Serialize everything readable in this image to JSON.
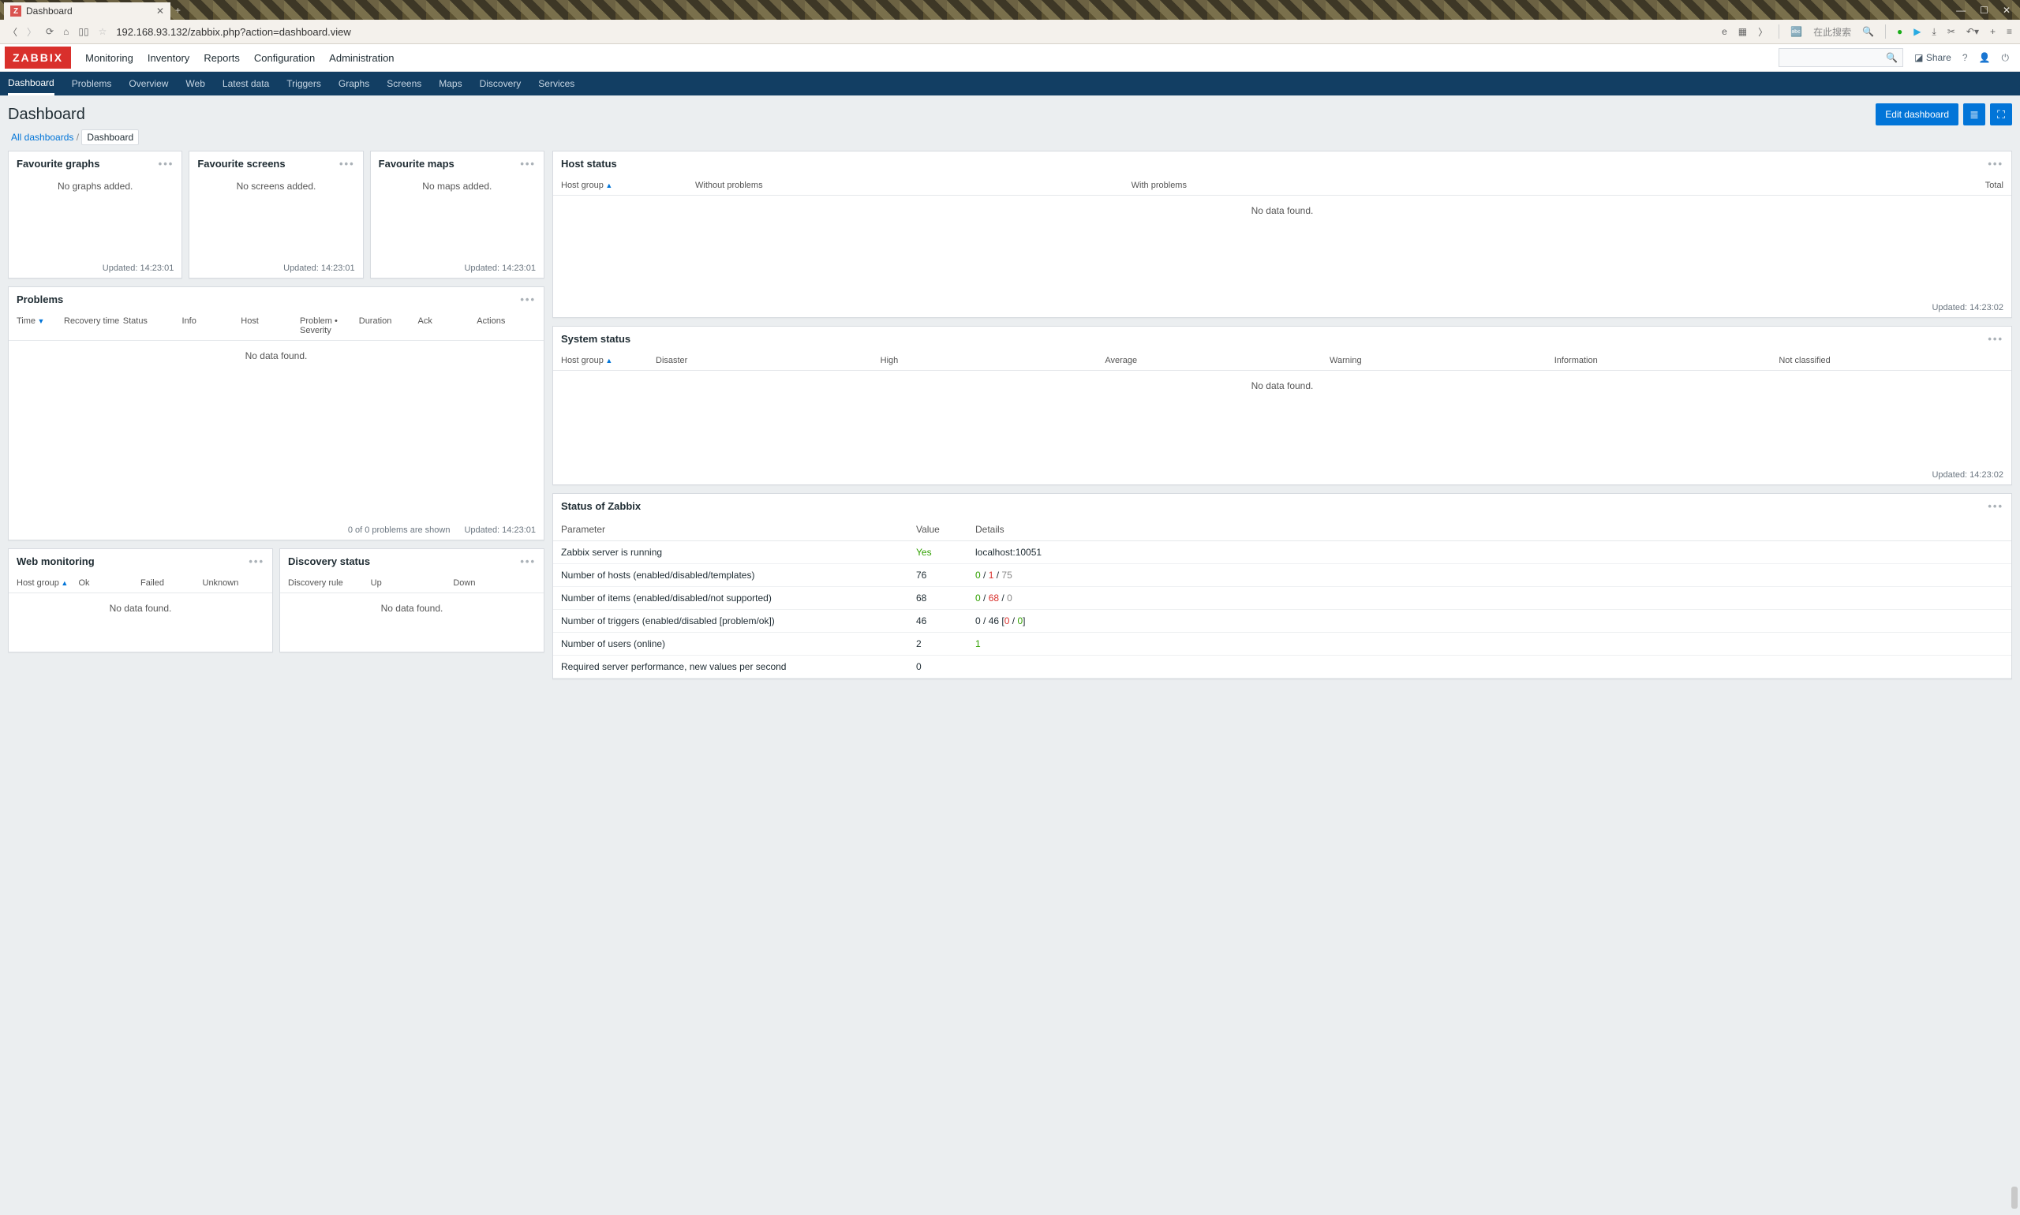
{
  "browser": {
    "tab_title": "Dashboard",
    "url": "192.168.93.132/zabbix.php?action=dashboard.view",
    "search_placeholder": "在此搜索"
  },
  "app": {
    "logo": "ZABBIX",
    "top_menu": [
      "Monitoring",
      "Inventory",
      "Reports",
      "Configuration",
      "Administration"
    ],
    "top_active": "Monitoring",
    "sub_menu": [
      "Dashboard",
      "Problems",
      "Overview",
      "Web",
      "Latest data",
      "Triggers",
      "Graphs",
      "Screens",
      "Maps",
      "Discovery",
      "Services"
    ],
    "sub_active": "Dashboard",
    "share_label": "Share"
  },
  "page": {
    "title": "Dashboard",
    "edit_btn": "Edit dashboard",
    "crumb1": "All dashboards",
    "crumb2": "Dashboard"
  },
  "widgets": {
    "fav_graphs": {
      "title": "Favourite graphs",
      "empty": "No graphs added.",
      "updated": "Updated: 14:23:01"
    },
    "fav_screens": {
      "title": "Favourite screens",
      "empty": "No screens added.",
      "updated": "Updated: 14:23:01"
    },
    "fav_maps": {
      "title": "Favourite maps",
      "empty": "No maps added.",
      "updated": "Updated: 14:23:01"
    },
    "problems": {
      "title": "Problems",
      "cols": [
        "Time",
        "Recovery time",
        "Status",
        "Info",
        "Host",
        "Problem • Severity",
        "Duration",
        "Ack",
        "Actions"
      ],
      "nodata": "No data found.",
      "foot_count": "0 of 0 problems are shown",
      "updated": "Updated: 14:23:01"
    },
    "web_mon": {
      "title": "Web monitoring",
      "cols": [
        "Host group",
        "Ok",
        "Failed",
        "Unknown"
      ],
      "nodata": "No data found."
    },
    "disc": {
      "title": "Discovery status",
      "cols": [
        "Discovery rule",
        "Up",
        "Down"
      ],
      "nodata": "No data found."
    },
    "host_status": {
      "title": "Host status",
      "cols": [
        "Host group",
        "Without problems",
        "With problems",
        "Total"
      ],
      "nodata": "No data found.",
      "updated": "Updated: 14:23:02"
    },
    "sys_status": {
      "title": "System status",
      "cols": [
        "Host group",
        "Disaster",
        "High",
        "Average",
        "Warning",
        "Information",
        "Not classified"
      ],
      "nodata": "No data found.",
      "updated": "Updated: 14:23:02"
    },
    "zbx_status": {
      "title": "Status of Zabbix",
      "head": [
        "Parameter",
        "Value",
        "Details"
      ],
      "rows": [
        {
          "p": "Zabbix server is running",
          "v": "Yes",
          "v_class": "green",
          "d": "localhost:10051"
        },
        {
          "p": "Number of hosts (enabled/disabled/templates)",
          "v": "76",
          "d_parts": [
            {
              "t": "0",
              "c": "green"
            },
            {
              "t": " / ",
              "c": ""
            },
            {
              "t": "1",
              "c": "red"
            },
            {
              "t": " / ",
              "c": ""
            },
            {
              "t": "75",
              "c": "grey"
            }
          ]
        },
        {
          "p": "Number of items (enabled/disabled/not supported)",
          "v": "68",
          "d_parts": [
            {
              "t": "0",
              "c": "green"
            },
            {
              "t": " / ",
              "c": ""
            },
            {
              "t": "68",
              "c": "red"
            },
            {
              "t": " / ",
              "c": ""
            },
            {
              "t": "0",
              "c": "grey"
            }
          ]
        },
        {
          "p": "Number of triggers (enabled/disabled [problem/ok])",
          "v": "46",
          "d_parts": [
            {
              "t": "0",
              "c": ""
            },
            {
              "t": " / ",
              "c": ""
            },
            {
              "t": "46",
              "c": ""
            },
            {
              "t": " [",
              "c": ""
            },
            {
              "t": "0",
              "c": "red"
            },
            {
              "t": " / ",
              "c": ""
            },
            {
              "t": "0",
              "c": "green"
            },
            {
              "t": "]",
              "c": ""
            }
          ]
        },
        {
          "p": "Number of users (online)",
          "v": "2",
          "d_parts": [
            {
              "t": "1",
              "c": "green"
            }
          ]
        },
        {
          "p": "Required server performance, new values per second",
          "v": "0",
          "d": ""
        }
      ]
    }
  }
}
